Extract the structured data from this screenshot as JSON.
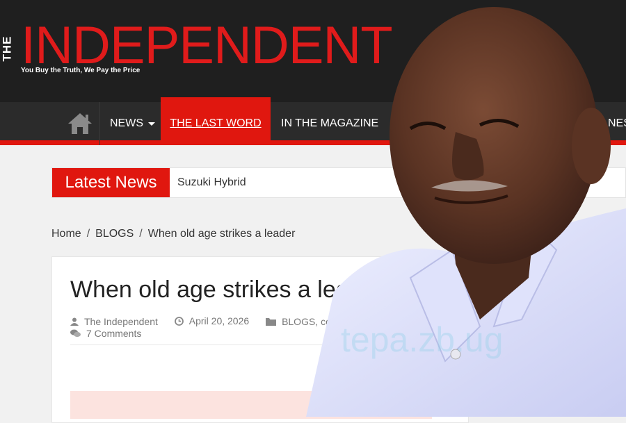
{
  "logo": {
    "the": "THE",
    "name": "INDEPENDENT",
    "tagline": "You Buy the Truth, We Pay the Price"
  },
  "nav": {
    "items": [
      "NEWS",
      "THE LAST WORD",
      "IN THE MAGAZINE",
      "NES"
    ],
    "active": "THE LAST WORD"
  },
  "ticker": {
    "label": "Latest News",
    "headline": "Suzuki Hybrid"
  },
  "breadcrumb": [
    "Home",
    "BLOGS",
    "When old age strikes a leader"
  ],
  "article": {
    "title": "When old age strikes a leader",
    "author": "The Independent",
    "date": "April 20, 2026",
    "categories": "BLOGS, commen",
    "comments": "7 Comments"
  },
  "watermark": "tepa.zb.ug",
  "colors": {
    "brand_red": "#e0170f",
    "header_bg": "#1f1f1f",
    "nav_bg": "#2b2b2b"
  }
}
